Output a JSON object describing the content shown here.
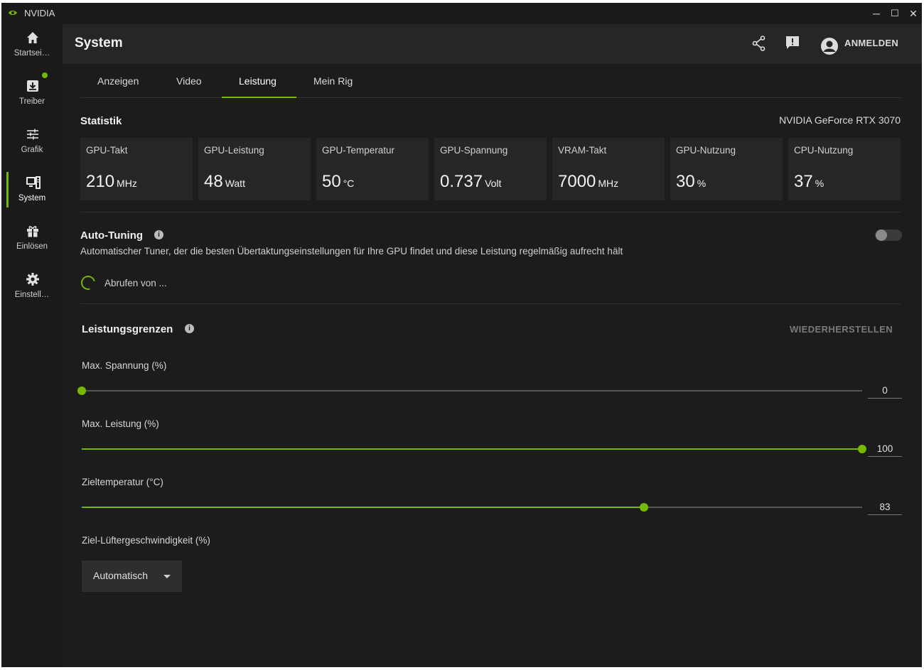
{
  "window": {
    "title": "NVIDIA",
    "minimize": "─",
    "maximize": "☐",
    "close": "✕"
  },
  "sidebar": {
    "items": [
      {
        "label": "Startsei…",
        "icon": "home-icon"
      },
      {
        "label": "Treiber",
        "icon": "driver-download-icon",
        "badge": true
      },
      {
        "label": "Grafik",
        "icon": "sliders-icon"
      },
      {
        "label": "System",
        "icon": "system-icon",
        "active": true
      },
      {
        "label": "Einlösen",
        "icon": "gift-icon"
      },
      {
        "label": "Einstell…",
        "icon": "gear-icon"
      }
    ]
  },
  "header": {
    "title": "System",
    "login_label": "ANMELDEN"
  },
  "tabs": [
    {
      "label": "Anzeigen"
    },
    {
      "label": "Video"
    },
    {
      "label": "Leistung",
      "active": true
    },
    {
      "label": "Mein Rig"
    }
  ],
  "statistics": {
    "title": "Statistik",
    "gpu_name": "NVIDIA GeForce RTX 3070",
    "cards": [
      {
        "label": "GPU-Takt",
        "value": "210",
        "unit": "MHz"
      },
      {
        "label": "GPU-Leistung",
        "value": "48",
        "unit": "Watt"
      },
      {
        "label": "GPU-Temperatur",
        "value": "50",
        "unit": "°C"
      },
      {
        "label": "GPU-Spannung",
        "value": "0.737",
        "unit": "Volt"
      },
      {
        "label": "VRAM-Takt",
        "value": "7000",
        "unit": "MHz"
      },
      {
        "label": "GPU-Nutzung",
        "value": "30",
        "unit": "%"
      },
      {
        "label": "CPU-Nutzung",
        "value": "37",
        "unit": "%"
      }
    ]
  },
  "auto_tuning": {
    "title": "Auto-Tuning",
    "description": "Automatischer Tuner, der die besten Übertaktungseinstellungen für Ihre GPU findet und diese Leistung regelmäßig aufrecht hält",
    "loading_text": "Abrufen von ...",
    "enabled": false
  },
  "limits": {
    "title": "Leistungsgrenzen",
    "restore_label": "WIEDERHERSTELLEN",
    "sliders": [
      {
        "label": "Max. Spannung (%)",
        "value": "0",
        "fraction": 0.0
      },
      {
        "label": "Max. Leistung (%)",
        "value": "100",
        "fraction": 1.0
      },
      {
        "label": "Zieltemperatur (°C)",
        "value": "83",
        "fraction": 0.72
      }
    ],
    "fan_label": "Ziel-Lüftergeschwindigkeit (%)",
    "fan_selected": "Automatisch"
  },
  "colors": {
    "accent": "#76b900",
    "background": "#1c1c1c",
    "card": "#262626"
  }
}
